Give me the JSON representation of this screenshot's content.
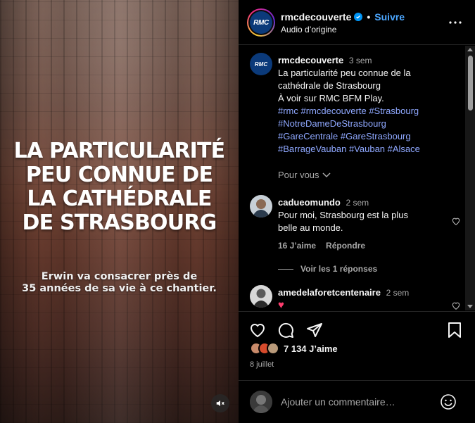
{
  "media": {
    "overlay_title": "LA PARTICULARITÉ\nPEU CONNUE DE\nLA CATHÉDRALE\nDE STRASBOURG",
    "overlay_subtitle": "Erwin va consacrer près de\n35 années de sa vie à ce chantier.",
    "mute_icon": "speaker-muted-icon"
  },
  "header": {
    "username": "rmcdecouverte",
    "separator": "•",
    "follow_label": "Suivre",
    "audio_label": "Audio d’origine",
    "logo_text": "RMC"
  },
  "caption": {
    "username": "rmcdecouverte",
    "time": "3 sem",
    "lines": [
      "La particularité peu connue de la",
      "cathédrale de Strasbourg",
      "À voir sur RMC BFM Play."
    ],
    "hashtag_lines": [
      "#rmc #rmcdecouverte #Strasbourg",
      "#NotreDameDeStrasbourg",
      "#GareCentrale #GareStrasbourg",
      "#BarrageVauban #Vauban #Alsace"
    ],
    "pour_vous": "Pour vous"
  },
  "comments": [
    {
      "username": "cadueomundo",
      "time": "2 sem",
      "text_lines": [
        "Pour moi, Strasbourg est la plus",
        "belle au monde."
      ],
      "likes": "16 J’aime",
      "reply_label": "Répondre",
      "view_replies": "Voir les 1 réponses"
    },
    {
      "username": "amedelaforetcentenaire",
      "time": "2 sem",
      "text": "♥"
    }
  ],
  "actions": {
    "like_icon": "heart-icon",
    "comment_icon": "comment-icon",
    "share_icon": "send-icon",
    "save_icon": "bookmark-icon"
  },
  "likes_summary": {
    "count_text": "7 134 J’aime",
    "date": "8 juillet"
  },
  "comment_input": {
    "placeholder": "Ajouter un commentaire…",
    "emoji_icon": "emoji-icon"
  },
  "colors": {
    "link_blue": "#4ca7ff",
    "hashtag": "#8fa8ff",
    "muted_text": "#a8a8a8",
    "heart_pink": "#ff3d6e"
  }
}
